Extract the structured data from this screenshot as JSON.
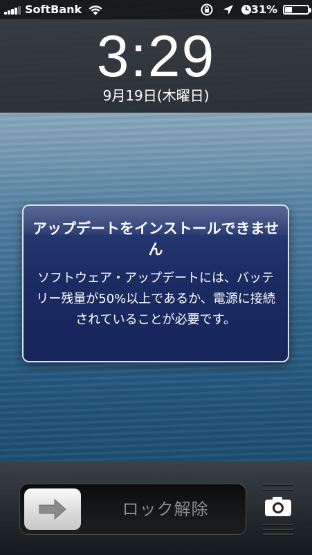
{
  "status_bar": {
    "carrier": "SoftBank",
    "battery_percent": "31%",
    "battery_level": 0.31,
    "icons": [
      "signal-icon",
      "wifi-icon",
      "rotation-lock-icon",
      "location-arrow-icon",
      "alarm-clock-icon",
      "battery-icon"
    ]
  },
  "lock_clock": {
    "time": "3:29",
    "date": "9月19日(木曜日)"
  },
  "alert": {
    "title": "アップデートをインストールできません",
    "message": "ソフトウェア・アップデートには、バッテリー残量が50%以上であるか、電源に接続されていることが必要です。"
  },
  "unlock": {
    "label": "ロック解除",
    "knob_icon": "arrow-right-icon"
  },
  "camera": {
    "icon": "camera-icon"
  }
}
